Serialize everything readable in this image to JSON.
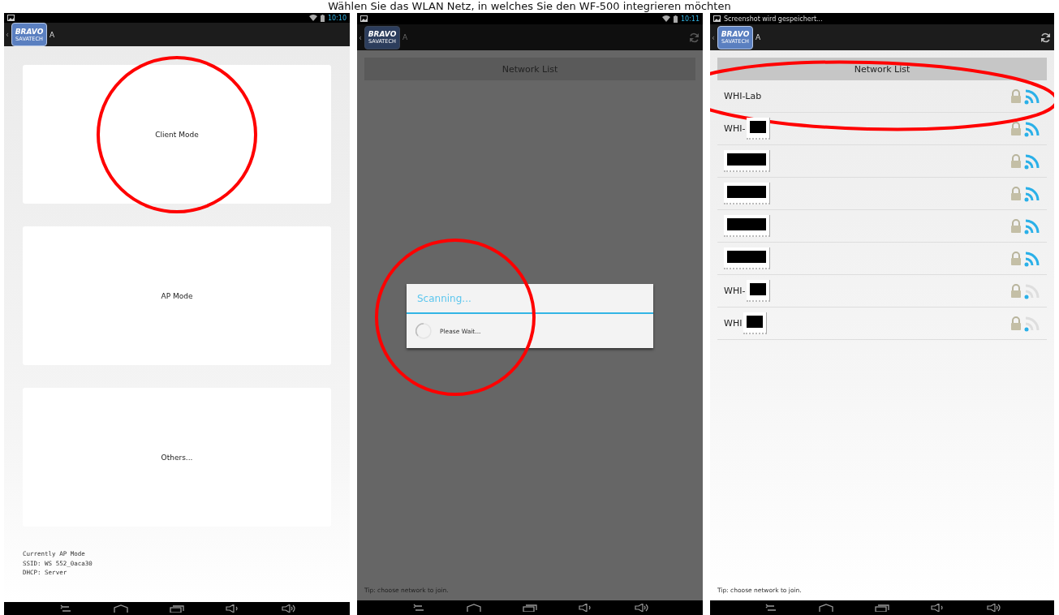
{
  "caption": "Wählen Sie das WLAN Netz, in welches Sie den WF-500 integrieren möchten",
  "screens": [
    {
      "kind": "mode_select",
      "status_bar": {
        "time": "10:10"
      },
      "action_bar": {
        "back": "‹",
        "logo": [
          "BRAVO",
          "SAVATECH"
        ],
        "title": "A",
        "refresh": false
      },
      "buttons": [
        {
          "label": "Client Mode",
          "highlighted": true
        },
        {
          "label": "AP Mode",
          "highlighted": false
        },
        {
          "label": "Others...",
          "highlighted": false
        }
      ],
      "info": [
        "Currently AP Mode",
        "SSID: WS 552_0aca30",
        "DHCP: Server"
      ]
    },
    {
      "kind": "network_list",
      "dimmed": true,
      "status_bar": {
        "time": "10:11"
      },
      "action_bar": {
        "back": "‹",
        "logo": [
          "BRAVO",
          "SAVATECH"
        ],
        "title": "A",
        "refresh": true
      },
      "header": "Network List",
      "dialog": {
        "title": "Scanning...",
        "message": "Please Wait...",
        "highlighted": true
      },
      "tip": "Tip: choose network to join."
    },
    {
      "kind": "network_list",
      "dimmed": false,
      "status_bar": {
        "notification": "Screenshot wird gespeichert..."
      },
      "action_bar": {
        "back": "‹",
        "logo": [
          "BRAVO",
          "SAVATECH"
        ],
        "title": "A",
        "refresh": true
      },
      "header": "Network List",
      "networks": [
        {
          "name": "WHI-Lab",
          "redacted": false,
          "strong": true,
          "highlighted": true
        },
        {
          "name": "WHI-",
          "redacted": true,
          "strong": true,
          "highlighted": false
        },
        {
          "redacted": true,
          "strong": true,
          "highlighted": false
        },
        {
          "redacted": true,
          "strong": true,
          "highlighted": false
        },
        {
          "redacted": true,
          "strong": true,
          "highlighted": false
        },
        {
          "redacted": true,
          "strong": true,
          "highlighted": false
        },
        {
          "name": "WHI-",
          "redacted": true,
          "strong": false,
          "highlighted": false
        },
        {
          "name": "WHI",
          "redacted": true,
          "strong": false,
          "highlighted": false
        }
      ],
      "tip": "Tip: choose network to join."
    }
  ]
}
